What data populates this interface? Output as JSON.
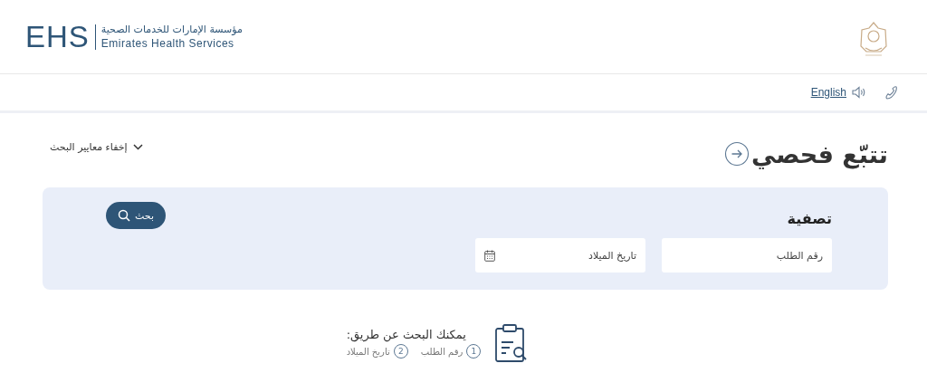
{
  "header": {
    "logo_mark": "EHS",
    "org_name_ar": "مؤسسة الإمارات للخدمات الصحية",
    "org_name_en": "Emirates Health Services"
  },
  "toolbar": {
    "language_link": "English"
  },
  "page": {
    "title": "تتبّع فحصي",
    "toggle_label": "إخفاء معايير البحث"
  },
  "filter": {
    "title": "تصفية",
    "search_button": "بحث",
    "fields": [
      {
        "kind": "text",
        "placeholder": "رقم الطلب"
      },
      {
        "kind": "date",
        "placeholder": "تاريخ الميلاد"
      }
    ]
  },
  "hint": {
    "title": "يمكنك البحث عن طريق:",
    "options": [
      {
        "number": "1",
        "label": "رقم الطلب"
      },
      {
        "number": "2",
        "label": "تاريخ الميلاد"
      }
    ]
  }
}
